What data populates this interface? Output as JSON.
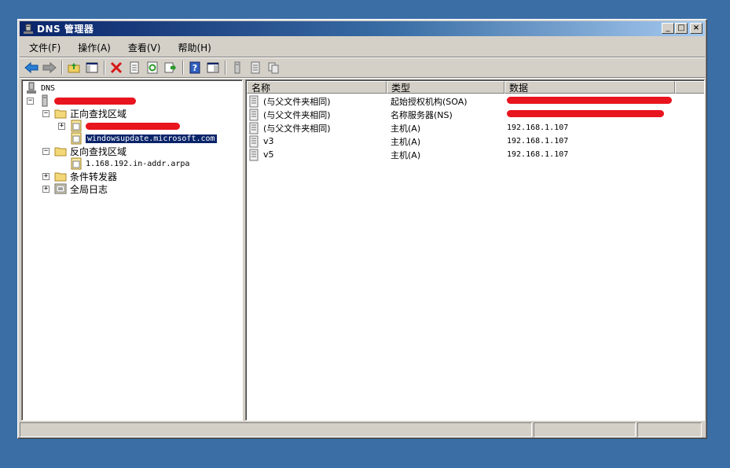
{
  "window": {
    "title": "DNS 管理器"
  },
  "menu": [
    "文件(F)",
    "操作(A)",
    "查看(V)",
    "帮助(H)"
  ],
  "tree": {
    "root": "DNS",
    "forward_zone": "正向查找区域",
    "forward_zone_child": "windowsupdate.microsoft.com",
    "reverse_zone": "反向查找区域",
    "reverse_zone_child": "1.168.192.in-addr.arpa",
    "conditional_forwarders": "条件转发器",
    "global_logs": "全局日志"
  },
  "list": {
    "columns": [
      "名称",
      "类型",
      "数据"
    ],
    "rows": [
      {
        "name": "(与父文件夹相同)",
        "type": "起始授权机构(SOA)",
        "data": ""
      },
      {
        "name": "(与父文件夹相同)",
        "type": "名称服务器(NS)",
        "data": ""
      },
      {
        "name": "(与父文件夹相同)",
        "type": "主机(A)",
        "data": "192.168.1.107"
      },
      {
        "name": "v3",
        "type": "主机(A)",
        "data": "192.168.1.107"
      },
      {
        "name": "v5",
        "type": "主机(A)",
        "data": "192.168.1.107"
      }
    ]
  }
}
